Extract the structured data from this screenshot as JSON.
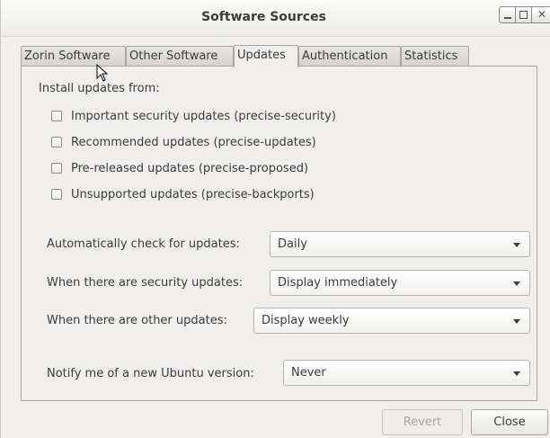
{
  "window": {
    "title": "Software Sources"
  },
  "tabs": [
    {
      "label": "Zorin Software",
      "active": false
    },
    {
      "label": "Other Software",
      "active": false
    },
    {
      "label": "Updates",
      "active": true
    },
    {
      "label": "Authentication",
      "active": false
    },
    {
      "label": "Statistics",
      "active": false
    }
  ],
  "updates": {
    "install_from_label": "Install updates from:",
    "sources": [
      {
        "label": "Important security updates (precise-security)",
        "checked": false
      },
      {
        "label": "Recommended updates (precise-updates)",
        "checked": false
      },
      {
        "label": "Pre-released updates (precise-proposed)",
        "checked": false
      },
      {
        "label": "Unsupported updates (precise-backports)",
        "checked": false
      }
    ],
    "auto_check": {
      "label": "Automatically check for updates:",
      "value": "Daily"
    },
    "security_updates": {
      "label": "When there are security updates:",
      "value": "Display immediately"
    },
    "other_updates": {
      "label": "When there are other updates:",
      "value": "Display weekly"
    },
    "notify_release": {
      "label": "Notify me of a new Ubuntu version:",
      "value": "Never"
    }
  },
  "buttons": {
    "revert": "Revert",
    "close": "Close"
  }
}
